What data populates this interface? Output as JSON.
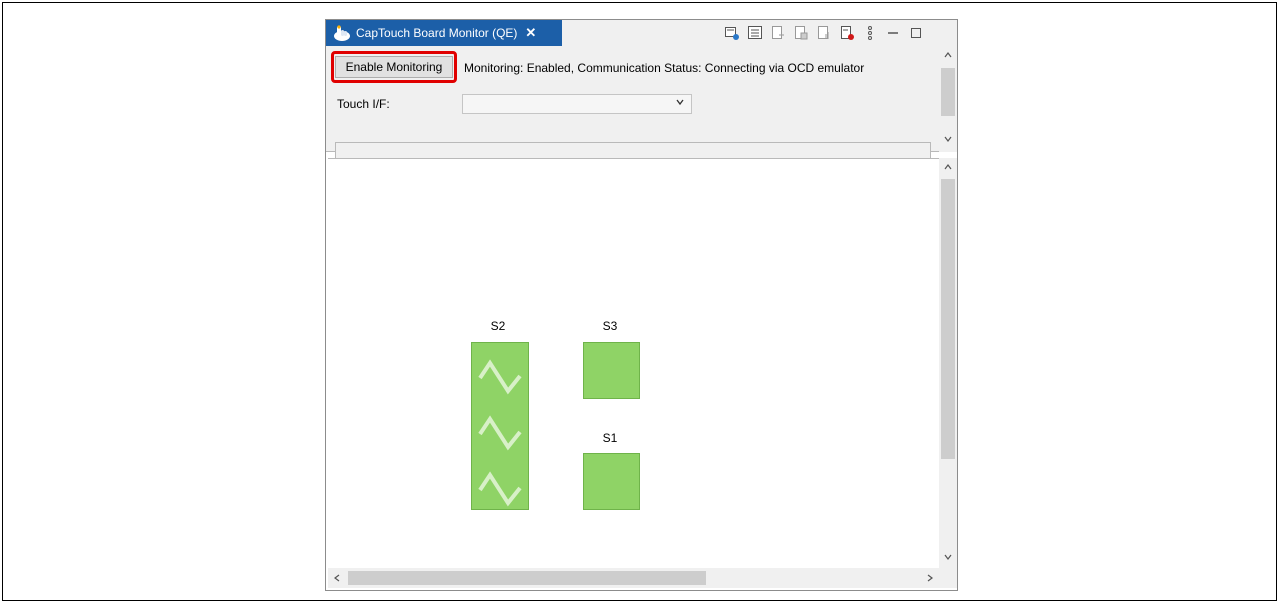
{
  "window": {
    "tab_title": "CapTouch Board Monitor (QE)",
    "tab_close": "✕",
    "accent_color": "#1c5fa8"
  },
  "toolbar": {
    "icons": [
      "refresh-icon",
      "window-list-icon",
      "export-icon",
      "import-icon",
      "settings-icon",
      "record-icon",
      "view-menu-icon",
      "minimize-icon",
      "maximize-icon"
    ]
  },
  "controls": {
    "enable_button_label": "Enable Monitoring",
    "status_text": "Monitoring: Enabled, Communication Status: Connecting via OCD emulator",
    "touch_if_label": "Touch I/F:",
    "touch_if_value": "",
    "readout_value": ""
  },
  "sensors": {
    "s2_label": "S2",
    "s3_label": "S3",
    "s1_label": "S1",
    "active_color": "#8fd366"
  }
}
